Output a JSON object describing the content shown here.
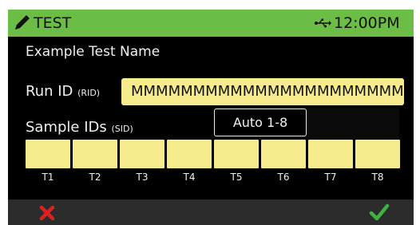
{
  "header": {
    "title": "TEST",
    "time": "12:00PM",
    "background": "#6cbd45",
    "icons": [
      "pen-icon",
      "usb-icon"
    ]
  },
  "test_name": "Example Test Name",
  "run_id": {
    "label": "Run ID",
    "tag": "(RID)",
    "value": "MMMMMMMMMMMMMMMMMMMMMM"
  },
  "sample_ids": {
    "label": "Sample IDs",
    "tag": "(SID)",
    "mode": "Auto 1-8"
  },
  "tubes": [
    "T1",
    "T2",
    "T3",
    "T4",
    "T5",
    "T6",
    "T7",
    "T8"
  ],
  "footer": {
    "cancel_icon": "cancel-x-icon",
    "confirm_icon": "confirm-check-icon",
    "cancel_color": "#e02020",
    "confirm_color": "#3fb33f"
  },
  "colors": {
    "field": "#f6ec8e",
    "screen": "#000000",
    "footer": "#2c2c2c"
  }
}
